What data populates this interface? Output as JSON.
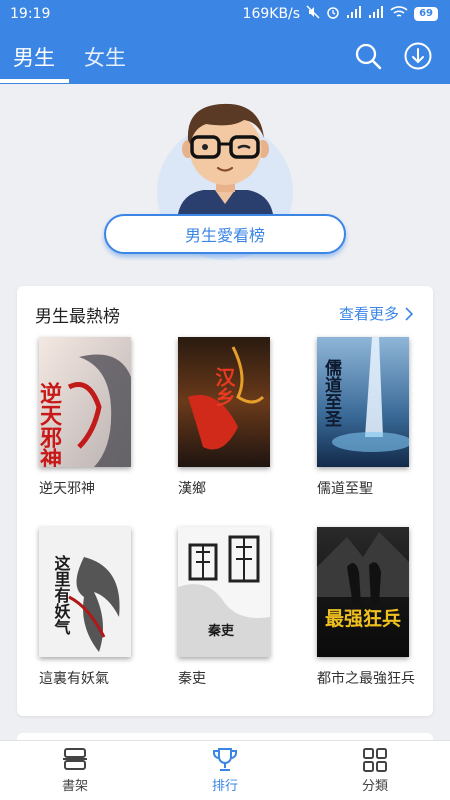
{
  "status_bar": {
    "time": "19:19",
    "net_speed": "169KB/s",
    "battery": "69"
  },
  "tabs": [
    {
      "label": "男生",
      "active": true
    },
    {
      "label": "女生",
      "active": false
    }
  ],
  "hero": {
    "button_label": "男生愛看榜"
  },
  "section": {
    "title": "男生最熱榜",
    "more_label": "查看更多",
    "books": [
      {
        "title": "逆天邪神",
        "cover_text": "逆天邪神"
      },
      {
        "title": "漢鄉",
        "cover_text": "汉乡"
      },
      {
        "title": "儒道至聖",
        "cover_text": "儒道至圣"
      },
      {
        "title": "這裏有妖氣",
        "cover_text": "这里有妖气"
      },
      {
        "title": "秦吏",
        "cover_text": "秦吏"
      },
      {
        "title": "都市之最強狂兵",
        "cover_text": "最强狂兵"
      }
    ]
  },
  "bottom_nav": [
    {
      "label": "書架",
      "icon": "bookshelf-icon",
      "active": false
    },
    {
      "label": "排行",
      "icon": "trophy-icon",
      "active": true
    },
    {
      "label": "分類",
      "icon": "grid-icon",
      "active": false
    }
  ],
  "colors": {
    "primary": "#3b86e5",
    "background": "#eeeff3"
  }
}
